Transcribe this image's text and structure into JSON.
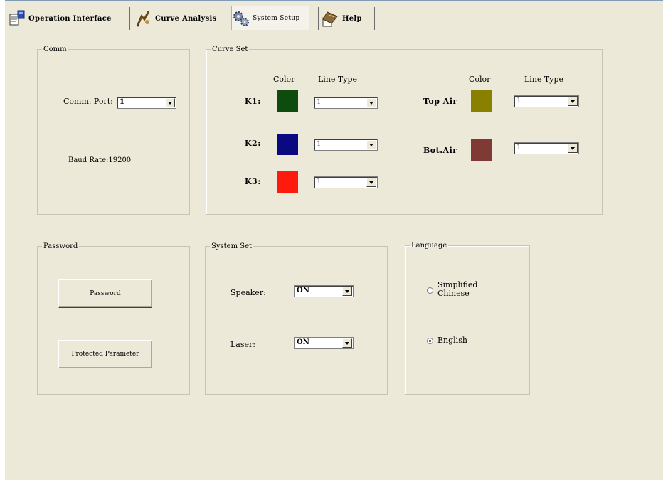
{
  "tabs": [
    {
      "label": "Operation Interface",
      "icon": "document-cube-icon"
    },
    {
      "label": "Curve Analysis",
      "icon": "pen-chart-icon"
    },
    {
      "label": "System Setup",
      "icon": "gears-icon",
      "active": true
    },
    {
      "label": "Help",
      "icon": "help-book-icon"
    }
  ],
  "comm": {
    "legend": "Comm",
    "port_label": "Comm. Port:",
    "port_value": "1",
    "baud_rate": "Baud Rate:19200"
  },
  "curve_set": {
    "legend": "Curve Set",
    "color_header": "Color",
    "linetype_header": "Line Type",
    "curves": [
      {
        "label": "K1:",
        "color": "#0f4a0f",
        "line_type": "1"
      },
      {
        "label": "K2:",
        "color": "#0a0a80",
        "line_type": "1"
      },
      {
        "label": "K3:",
        "color": "#ff1a10",
        "line_type": "1"
      },
      {
        "label": "Top Air",
        "color": "#8a8000",
        "line_type": "1"
      },
      {
        "label": "Bot.Air",
        "color": "#7f3a35",
        "line_type": "1"
      }
    ]
  },
  "password": {
    "legend": "Password",
    "password_button": "Password",
    "protected_button": "Protected Parameter"
  },
  "system_set": {
    "legend": "System Set",
    "speaker_label": "Speaker:",
    "speaker_value": "ON",
    "laser_label": "Laser:",
    "laser_value": "ON"
  },
  "language": {
    "legend": "Language",
    "options": [
      {
        "label": "Simplified Chinese",
        "line1": "Simplified",
        "line2": "Chinese",
        "checked": false
      },
      {
        "label": "English",
        "checked": true
      }
    ]
  }
}
